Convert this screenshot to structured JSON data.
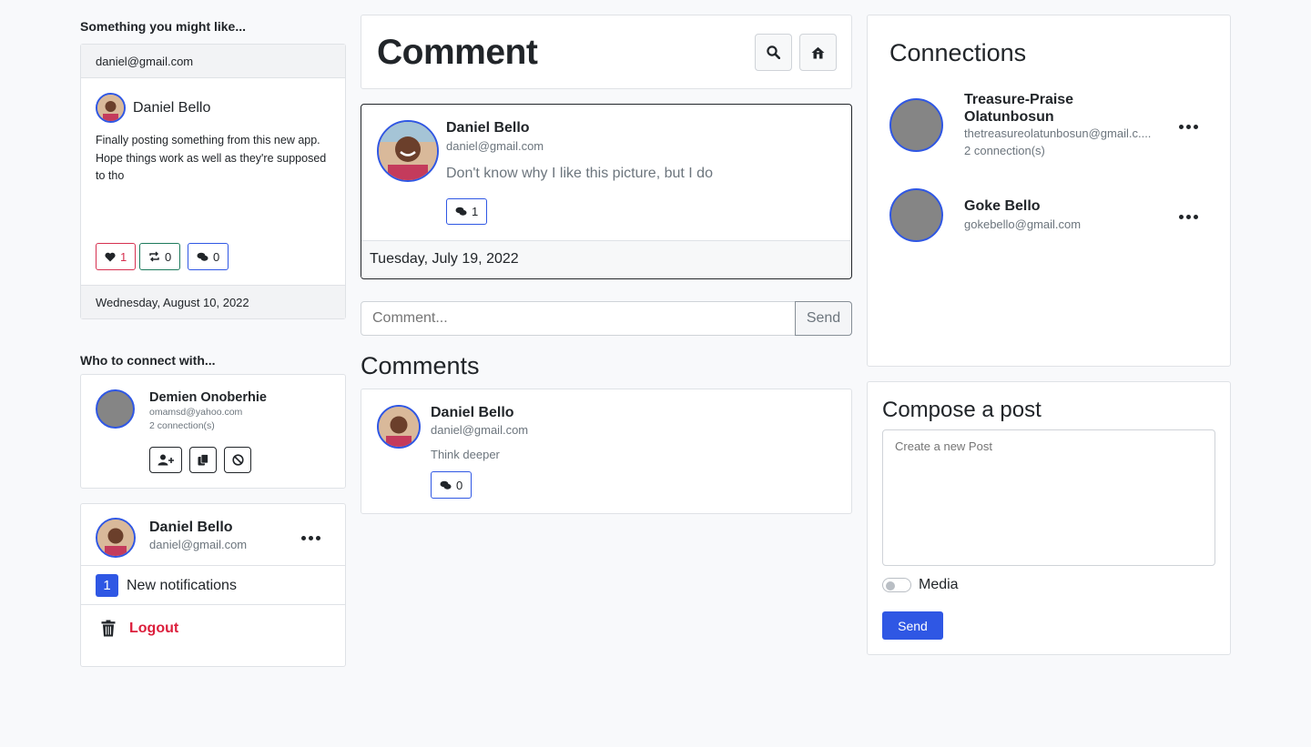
{
  "suggested": {
    "heading": "Something you might like...",
    "card_header": "daniel@gmail.com",
    "author": "Daniel Bello",
    "text": "Finally posting something from this new app. Hope things work as well as they're supposed to tho",
    "likes": "1",
    "reposts": "0",
    "comments": "0",
    "date": "Wednesday, August 10, 2022"
  },
  "connect": {
    "heading": "Who to connect with...",
    "name": "Demien Onoberhie",
    "email": "omamsd@yahoo.com",
    "connections": "2 connection(s)"
  },
  "profile": {
    "name": "Daniel Bello",
    "email": "daniel@gmail.com",
    "notif_count": "1",
    "notif_label": "New notifications",
    "logout": "Logout"
  },
  "main": {
    "title": "Comment",
    "post": {
      "author": "Daniel Bello",
      "email": "daniel@gmail.com",
      "text": "Don't know why I like this picture, but I do",
      "comment_count": "1",
      "date": "Tuesday, July 19, 2022"
    },
    "comment_input": {
      "placeholder": "Comment...",
      "send": "Send"
    },
    "comments_heading": "Comments",
    "comments": [
      {
        "author": "Daniel Bello",
        "email": "daniel@gmail.com",
        "text": "Think deeper",
        "count": "0"
      }
    ]
  },
  "connections": {
    "heading": "Connections",
    "items": [
      {
        "name": "Treasure-Praise Olatunbosun",
        "email": "thetreasureolatunbosun@gmail.c....",
        "count": "2 connection(s)"
      },
      {
        "name": "Goke Bello",
        "email": "gokebello@gmail.com"
      }
    ]
  },
  "compose": {
    "heading": "Compose a post",
    "placeholder": "Create a new Post",
    "media_label": "Media",
    "send": "Send"
  },
  "colors": {
    "accent": "#2f57e4",
    "like": "#d63050",
    "repost": "#1d7a5c",
    "logout": "#dc1f3c"
  },
  "icons": [
    "search-icon",
    "home-icon",
    "heart-icon",
    "repost-icon",
    "comments-icon",
    "add-user-icon",
    "copy-icon",
    "block-icon",
    "more-icon",
    "trash-icon"
  ]
}
